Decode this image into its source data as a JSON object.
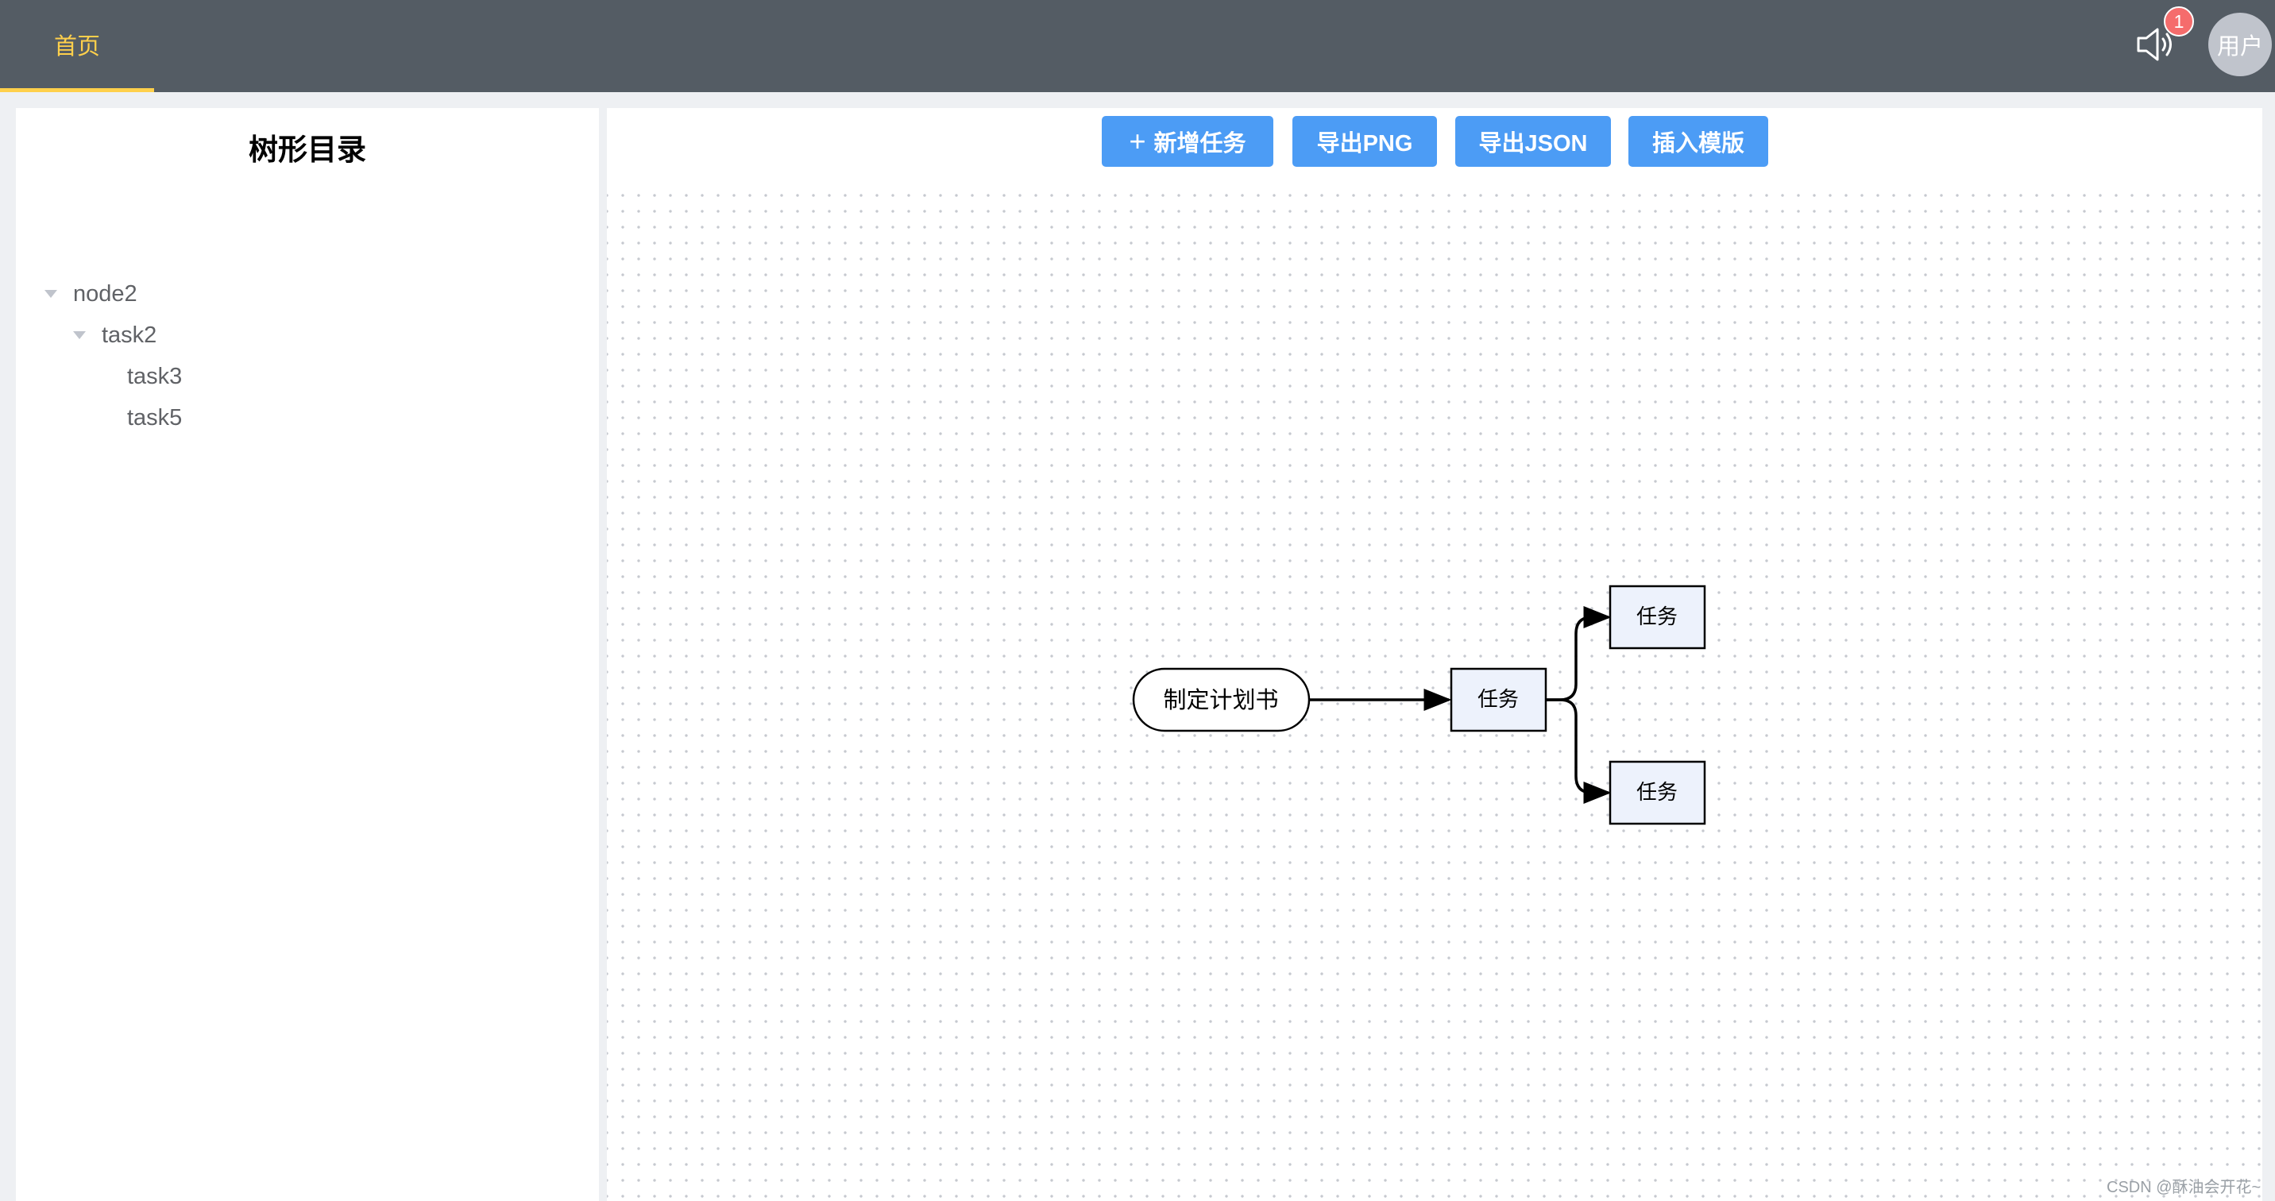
{
  "header": {
    "nav_tab": "首页",
    "notification_count": "1",
    "avatar_label": "用户",
    "accent_color": "#ffd04b",
    "bar_color": "#545c64"
  },
  "sidebar": {
    "title": "树形目录",
    "tree": [
      {
        "label": "node2",
        "expanded": true
      },
      {
        "label": "task2",
        "expanded": true
      },
      {
        "label": "task3"
      },
      {
        "label": "task5"
      }
    ]
  },
  "toolbar": {
    "add_task": "新增任务",
    "add_icon": "plus-icon",
    "export_png": "导出PNG",
    "export_json": "导出JSON",
    "insert_template": "插入模版",
    "button_color": "#4c9cf5"
  },
  "graph": {
    "start_node": "制定计划书",
    "task_node": "任务",
    "branch_top": "任务",
    "branch_bottom": "任务"
  },
  "watermark": "CSDN @酥油会开花~"
}
